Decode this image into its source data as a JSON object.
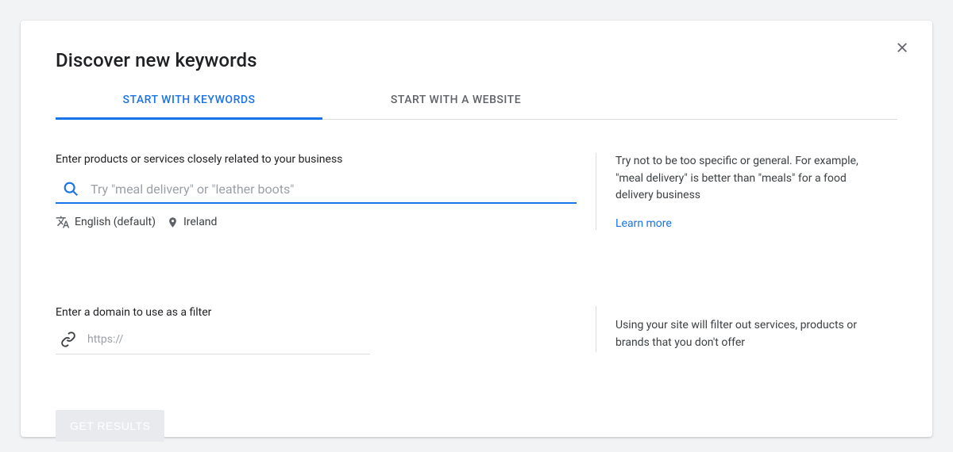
{
  "title": "Discover new keywords",
  "tabs": {
    "keywords": "START WITH KEYWORDS",
    "website": "START WITH A WEBSITE"
  },
  "section1": {
    "label": "Enter products or services closely related to your business",
    "placeholder": "Try \"meal delivery\" or \"leather boots\"",
    "language": "English (default)",
    "location": "Ireland",
    "hint": "Try not to be too specific or general. For example, \"meal delivery\" is better than \"meals\" for a food delivery business",
    "learn_more": "Learn more"
  },
  "section2": {
    "label": "Enter a domain to use as a filter",
    "placeholder": "https://",
    "hint": "Using your site will filter out services, products or brands that you don't offer"
  },
  "submit": "GET RESULTS"
}
